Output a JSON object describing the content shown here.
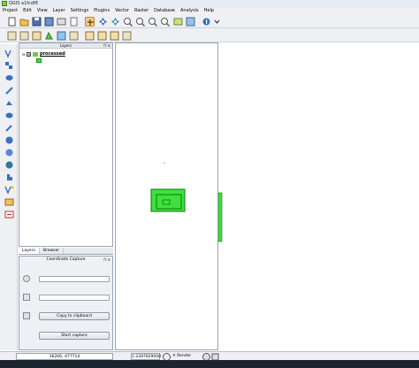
{
  "window": {
    "title": "QGIS a1fcdf8"
  },
  "menubar": {
    "items": [
      "Project",
      "Edit",
      "View",
      "Layer",
      "Settings",
      "Plugins",
      "Vector",
      "Raster",
      "Database",
      "Analysis",
      "Help"
    ]
  },
  "layers_panel": {
    "title": "Layers",
    "layer": {
      "name": "processed",
      "checked_mark": "✕",
      "expand_mark": "⊟"
    }
  },
  "tabs": [
    {
      "label": "Layers"
    },
    {
      "label": "Browser"
    }
  ],
  "coordinate_capture": {
    "title": "Coordinate Capture",
    "field1_value": "",
    "field2_value": "",
    "copy_button": "Copy to clipboard",
    "start_button": "Start capture"
  },
  "status": {
    "coordinates": "36206,-477714",
    "scale": "1:2287829000",
    "render_label": "Render"
  },
  "colors": {
    "feature_fill": "#3fe03f",
    "feature_stroke": "#0a7a0a"
  }
}
